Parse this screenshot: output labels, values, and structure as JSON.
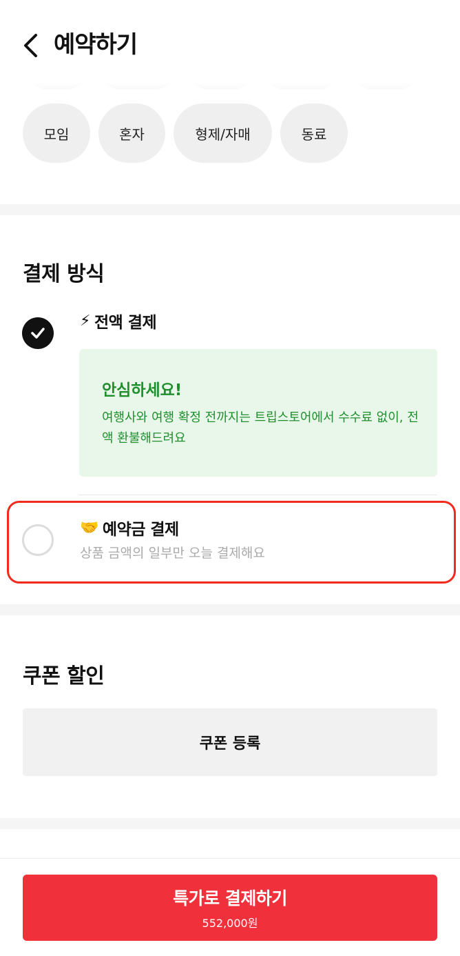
{
  "header": {
    "title": "예약하기",
    "back_icon": "chevron-left-icon"
  },
  "companions": {
    "chips": [
      "모임",
      "혼자",
      "형제/자매",
      "동료"
    ]
  },
  "payment": {
    "title": "결제 방식",
    "full": {
      "icon": "⚡",
      "label": "전액 결제",
      "checked": true,
      "info_title": "안심하세요!",
      "info_text": "여행사와 여행 확정 전까지는 트립스토어에서 수수료 없이, 전액 환불해드려요"
    },
    "deposit": {
      "icon": "🤝",
      "label": "예약금 결제",
      "description": "상품 금액의 일부만 오늘 결제해요",
      "checked": false
    }
  },
  "coupon": {
    "title": "쿠폰 할인",
    "button_label": "쿠폰 등록"
  },
  "checkout": {
    "button_label": "특가로 결제하기",
    "price": "552,000원"
  },
  "colors": {
    "accent_red": "#f0303a",
    "highlight_red": "#f02a1c",
    "info_green": "#1f8f2e",
    "info_bg": "#e8f7e9"
  }
}
